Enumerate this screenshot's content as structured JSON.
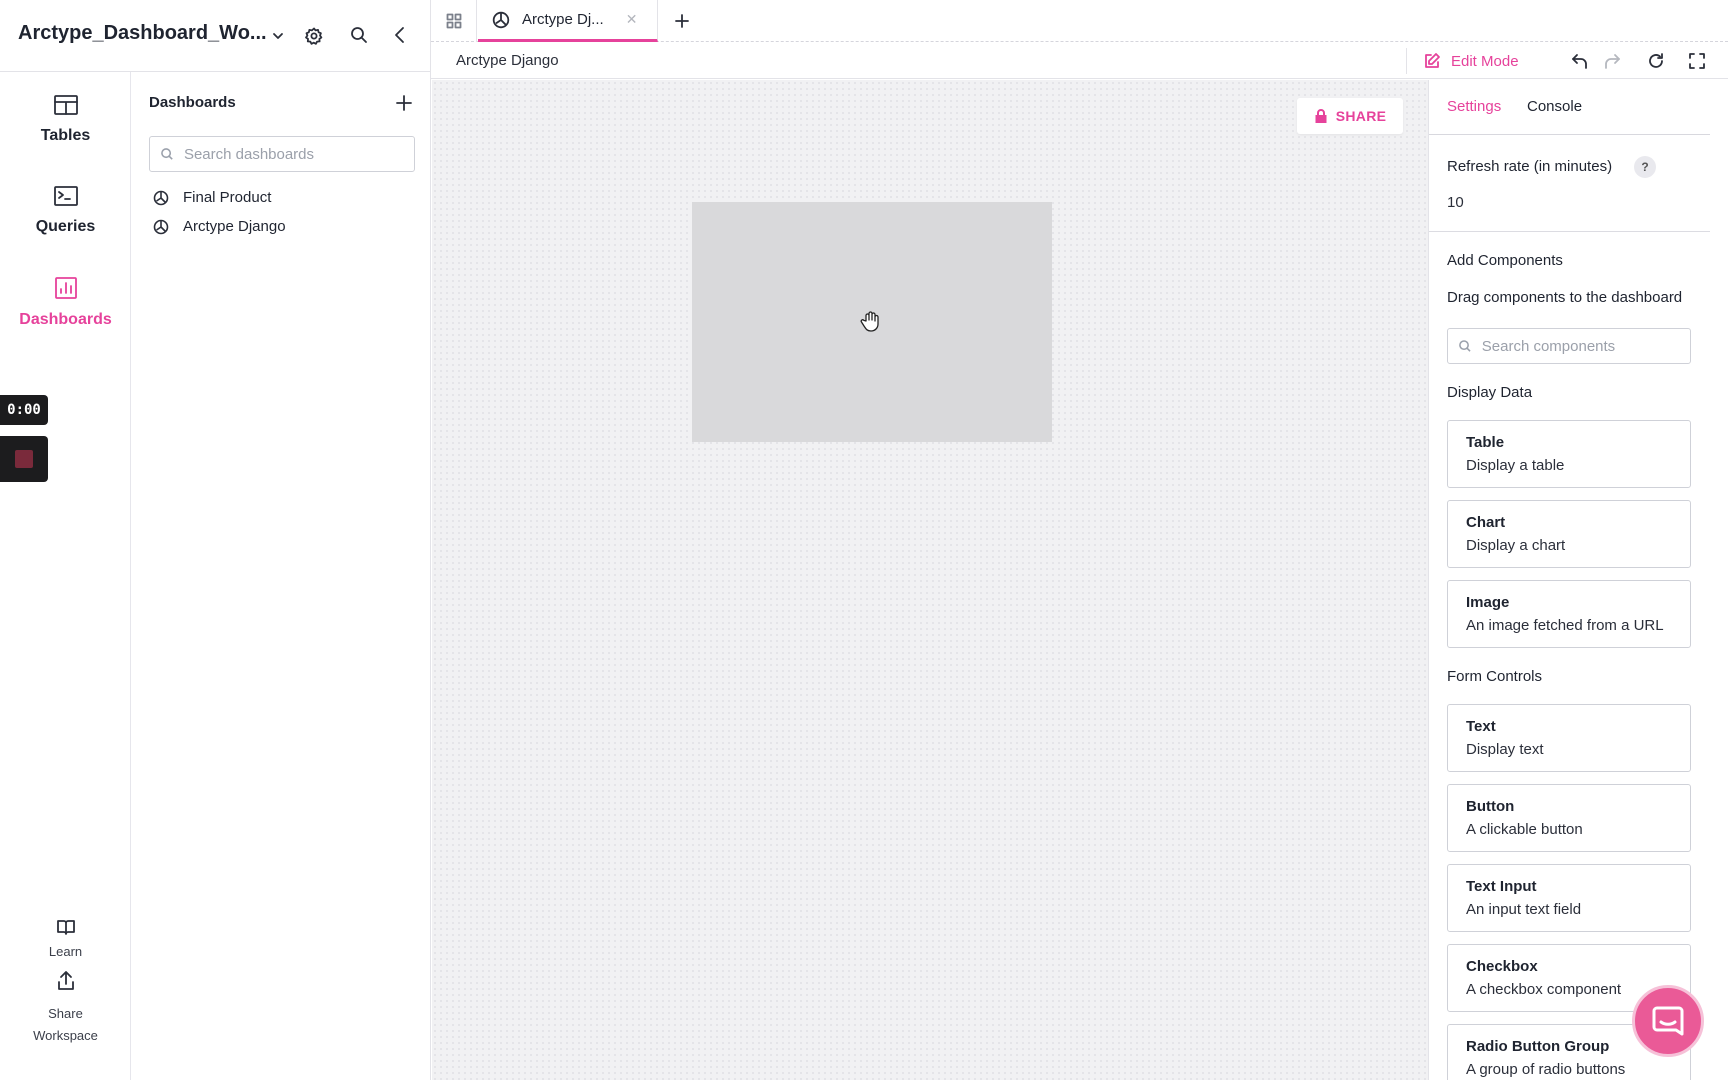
{
  "workspace": {
    "title": "Arctype_Dashboard_Wo..."
  },
  "rail": {
    "items": [
      {
        "label": "Tables",
        "icon": "table-icon"
      },
      {
        "label": "Queries",
        "icon": "terminal-icon"
      },
      {
        "label": "Dashboards",
        "icon": "bar-chart-icon",
        "active": true
      }
    ],
    "learn_label": "Learn",
    "share_label_line1": "Share",
    "share_label_line2": "Workspace"
  },
  "recorder": {
    "time": "0:00"
  },
  "dashboards_panel": {
    "heading": "Dashboards",
    "search_placeholder": "Search dashboards",
    "items": [
      {
        "label": "Final Product",
        "icon": "dashboard-icon"
      },
      {
        "label": "Arctype Django",
        "icon": "dashboard-icon"
      }
    ]
  },
  "tabs": {
    "active_label": "Arctype Dj...",
    "close_glyph": "✕"
  },
  "toolbar": {
    "breadcrumb": "Arctype Django",
    "edit_mode_label": "Edit Mode"
  },
  "canvas": {
    "share_label": "SHARE"
  },
  "right_panel": {
    "tabs": [
      {
        "label": "Settings",
        "active": true
      },
      {
        "label": "Console",
        "active": false
      }
    ],
    "refresh_label": "Refresh rate (in minutes)",
    "refresh_value": "10",
    "help_glyph": "?",
    "add_components_heading": "Add Components",
    "add_components_hint": "Drag components to the dashboard",
    "search_placeholder": "Search components",
    "display_data_heading": "Display Data",
    "display_data": [
      {
        "name": "Table",
        "desc": "Display a table"
      },
      {
        "name": "Chart",
        "desc": "Display a chart"
      },
      {
        "name": "Image",
        "desc": "An image fetched from a URL"
      }
    ],
    "form_controls_heading": "Form Controls",
    "form_controls": [
      {
        "name": "Text",
        "desc": "Display text"
      },
      {
        "name": "Button",
        "desc": "A clickable button"
      },
      {
        "name": "Text Input",
        "desc": "An input text field"
      },
      {
        "name": "Checkbox",
        "desc": "A checkbox component"
      },
      {
        "name": "Radio Button Group",
        "desc": "A group of radio buttons"
      }
    ]
  },
  "colors": {
    "accent": "#e6429b",
    "canvas_bg": "#f1f1f3",
    "placeholder_block": "#d9d9db",
    "chat_bubble": "#ea5a97"
  }
}
